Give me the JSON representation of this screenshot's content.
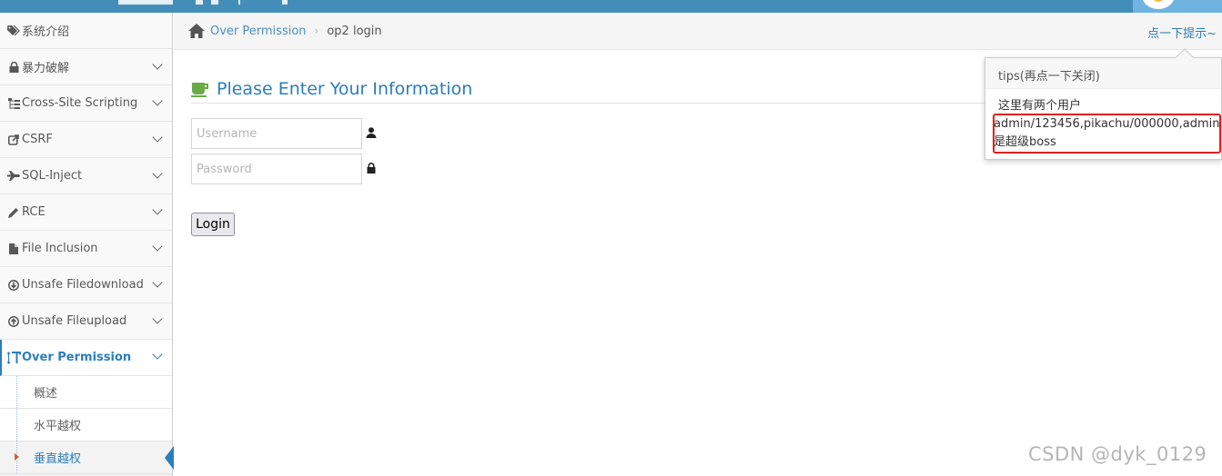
{
  "sidebar": {
    "items": [
      {
        "label": "系统介绍",
        "icon": "tags-icon"
      },
      {
        "label": "暴力破解",
        "icon": "lock-icon"
      },
      {
        "label": "Cross-Site Scripting",
        "icon": "sitemap-icon"
      },
      {
        "label": "CSRF",
        "icon": "share-icon"
      },
      {
        "label": "SQL-Inject",
        "icon": "fighter-jet-icon"
      },
      {
        "label": "RCE",
        "icon": "pencil-icon"
      },
      {
        "label": "File Inclusion",
        "icon": "file-icon"
      },
      {
        "label": "Unsafe Filedownload",
        "icon": "download-circle-icon"
      },
      {
        "label": "Unsafe Fileupload",
        "icon": "upload-circle-icon"
      },
      {
        "label": "Over Permission",
        "icon": "text-height-icon"
      }
    ],
    "subitems": [
      {
        "label": "概述"
      },
      {
        "label": "水平越权"
      },
      {
        "label": "垂直越权"
      }
    ]
  },
  "breadcrumb": {
    "parent": "Over Permission",
    "current": "op2 login",
    "hint": "点一下提示~"
  },
  "main": {
    "title": "Please Enter Your Information",
    "username_placeholder": "Username",
    "password_placeholder": "Password",
    "login_label": "Login"
  },
  "tips": {
    "title": "tips(再点一下关闭)",
    "line1": "这里有两个用户",
    "line2": "admin/123456,pikachu/000000,admin",
    "line3": "是超级boss"
  },
  "watermark": "CSDN @dyk_0129",
  "colors": {
    "accent": "#2b7dbc",
    "topbar": "#438eb9",
    "highlight_border": "#e02020"
  }
}
